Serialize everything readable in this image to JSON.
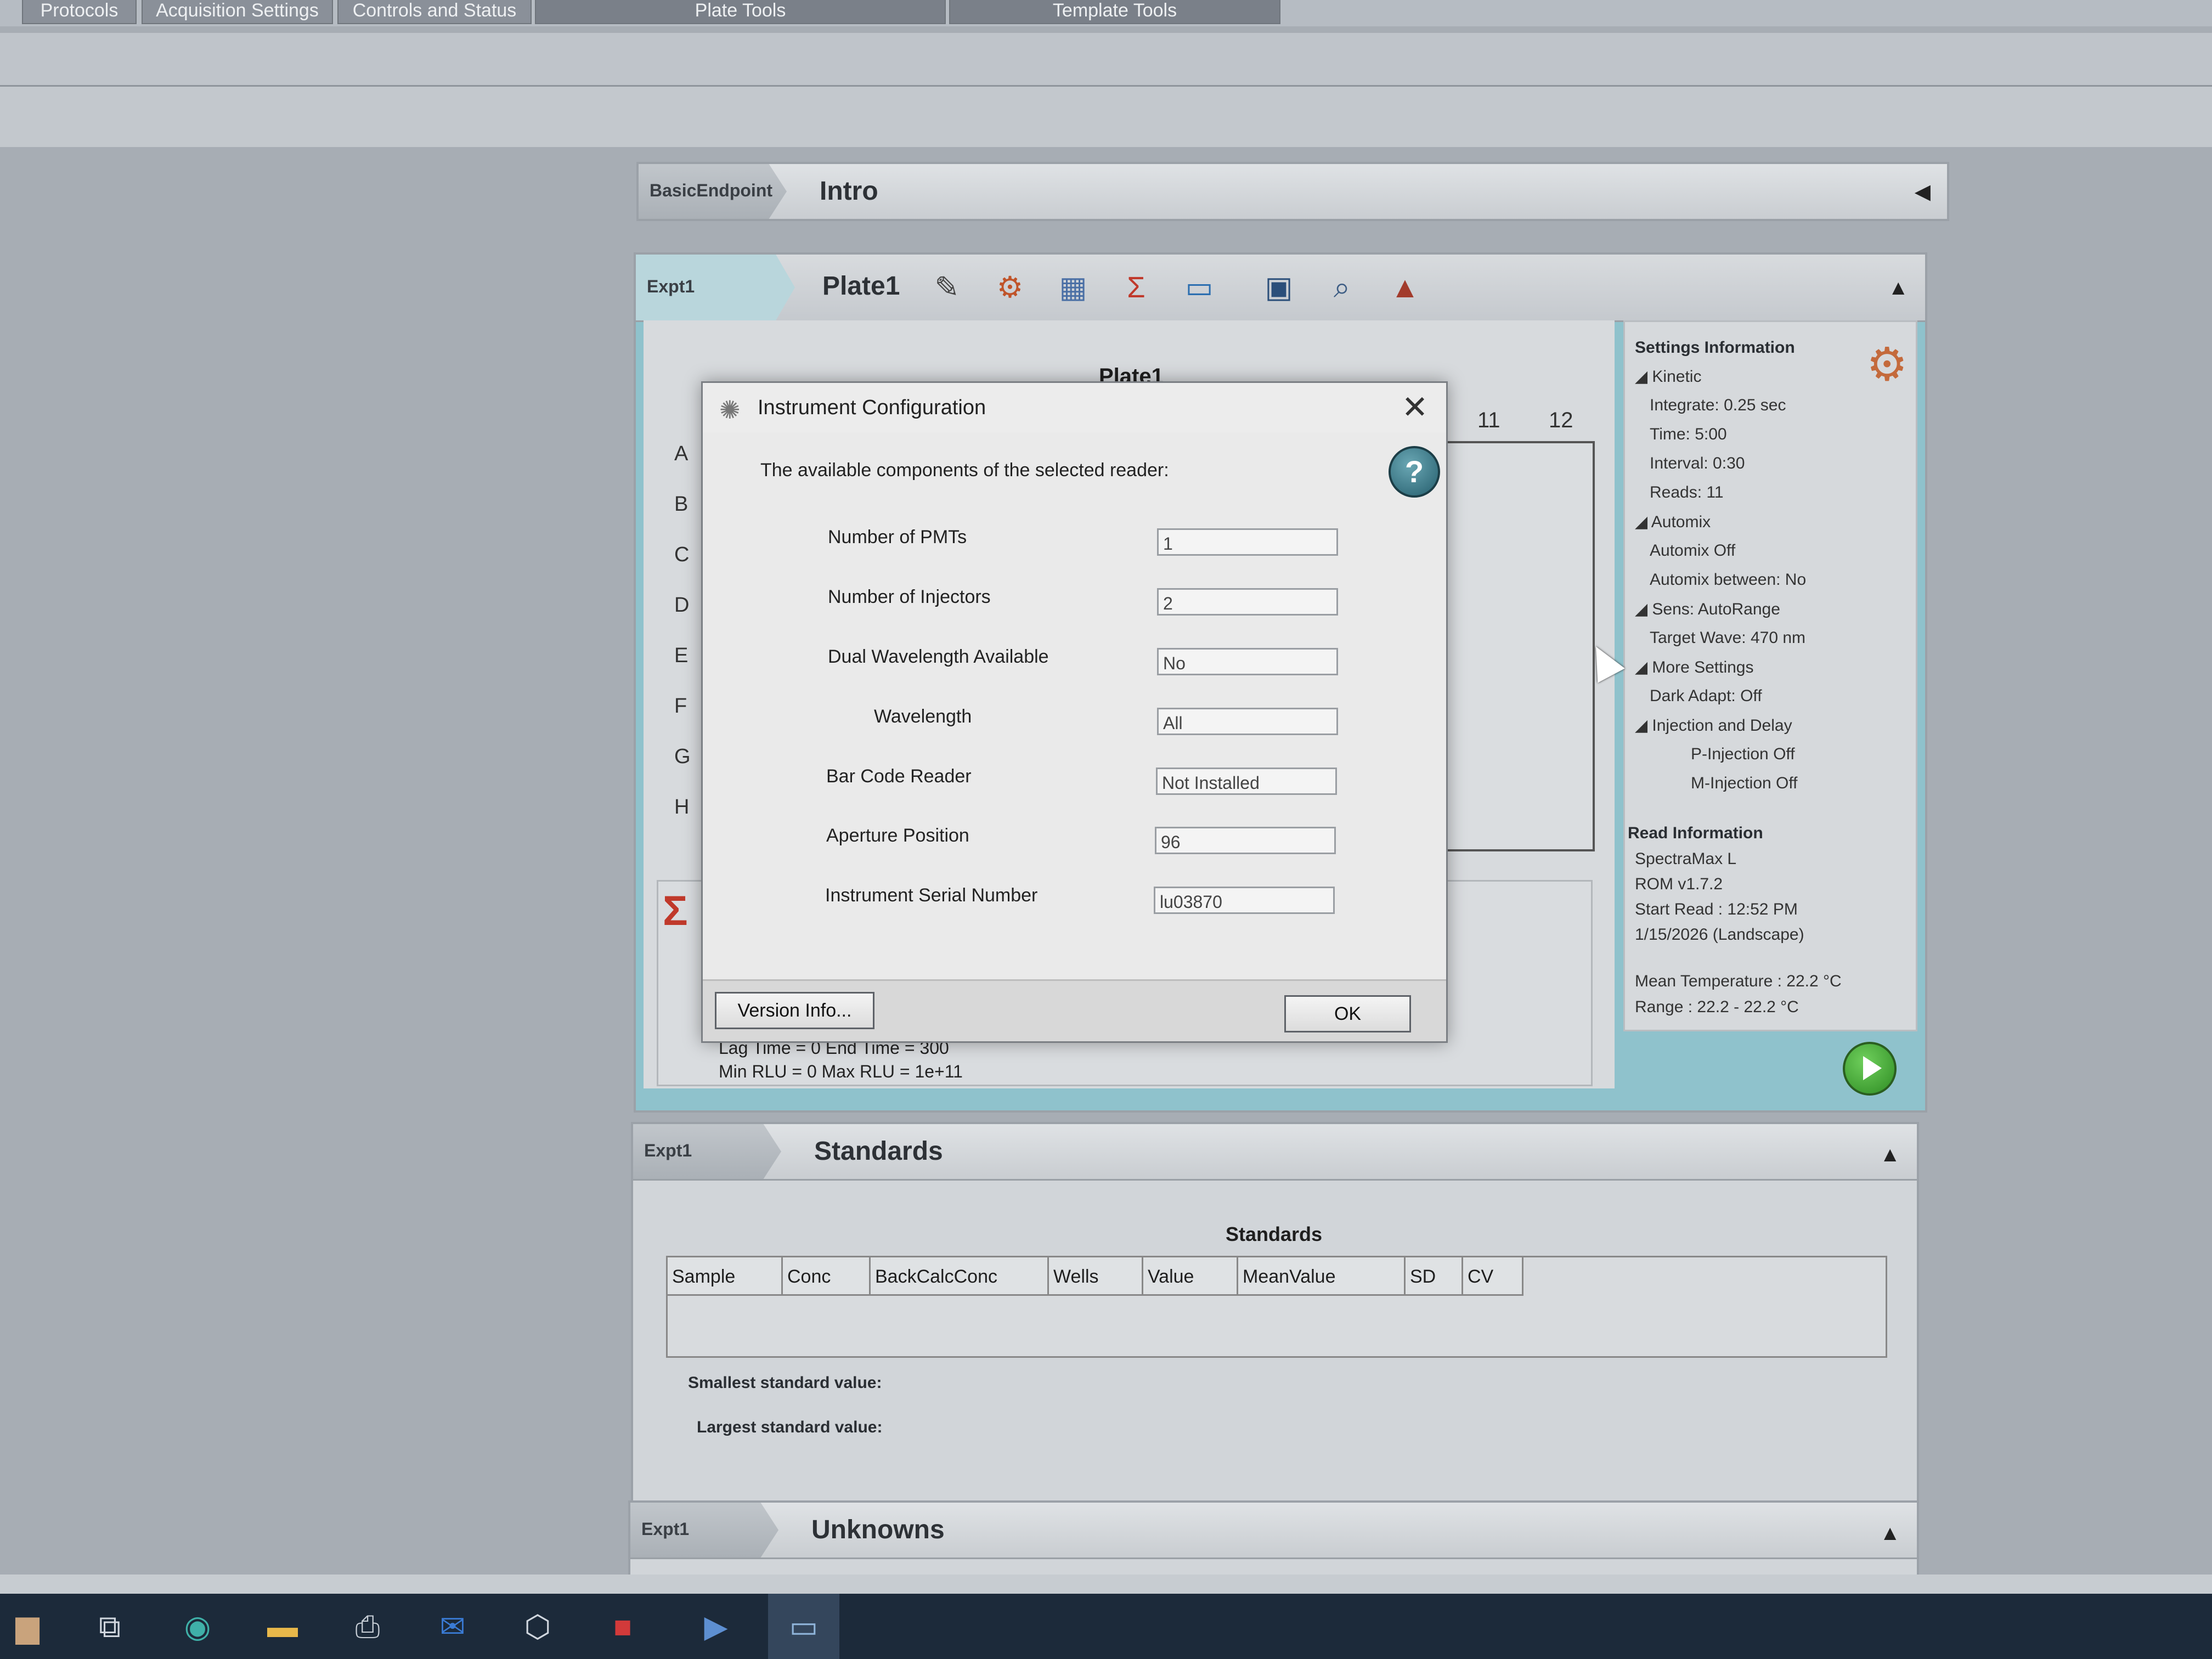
{
  "ribbon": {
    "tabs": [
      "Protocols",
      "Acquisition Settings",
      "Controls and Status",
      "Plate Tools",
      "Template Tools"
    ]
  },
  "intro_section": {
    "name": "BasicEndpoint",
    "title": "Intro",
    "collapse_icon": "triangle-left-icon"
  },
  "plate_section": {
    "name": "Expt1",
    "title": "Plate1",
    "toolbar_icons": [
      "magic-wand-icon",
      "plate-layout-icon",
      "template-icon",
      "reduction-sigma-icon",
      "display-icon",
      "graph-icon",
      "zoom-icon",
      "mask-icon"
    ],
    "plate_caption": "Plate1",
    "rows": [
      "A",
      "B",
      "C",
      "D",
      "E",
      "F",
      "G",
      "H"
    ],
    "columns_visible": [
      "11",
      "12"
    ],
    "reduction_lines": [
      "Lag Time = 0 End Time = 300",
      "Min RLU = 0 Max RLU = 1e+11"
    ],
    "settings_info": {
      "title": "Settings Information",
      "kinetic": "Kinetic",
      "integrate": "Integrate:  0.25 sec",
      "time": "Time:  5:00",
      "interval": "Interval:  0:30",
      "reads": "Reads:  11",
      "automix": "Automix",
      "automix_state": "Automix  Off",
      "automix_between": "Automix between:  No",
      "sens": "Sens: AutoRange",
      "target_wave": "Target Wave:  470 nm",
      "more_settings": "More Settings",
      "dark_adapt": "Dark Adapt:  Off",
      "injection_delay": "Injection and Delay",
      "p_injection": "P-Injection Off",
      "m_injection": "M-Injection Off",
      "read_info_title": "Read Information",
      "reader": "SpectraMax L",
      "rom": "ROM v1.7.2",
      "start_read": "Start Read : 12:52 PM",
      "date": "1/15/2026 (Landscape)",
      "mean_temp": "Mean Temperature : 22.2 °C",
      "range": "Range : 22.2 - 22.2 °C"
    }
  },
  "standards_section": {
    "name": "Expt1",
    "title": "Standards",
    "caption": "Standards",
    "columns": [
      "Sample",
      "Conc",
      "BackCalcConc",
      "Wells",
      "Value",
      "MeanValue",
      "SD",
      "CV"
    ],
    "smallest_label": "Smallest standard value:",
    "largest_label": "Largest standard value:"
  },
  "unknowns_section": {
    "name": "Expt1",
    "title": "Unknowns"
  },
  "dialog": {
    "title": "Instrument Configuration",
    "description": "The available components of the selected reader:",
    "help_label": "?",
    "fields": [
      {
        "label": "Number of PMTs",
        "value": "1"
      },
      {
        "label": "Number of Injectors",
        "value": "2"
      },
      {
        "label": "Dual Wavelength Available",
        "value": "No"
      },
      {
        "label": "Wavelength",
        "value": "All"
      },
      {
        "label": "Bar Code Reader",
        "value": "Not Installed"
      },
      {
        "label": "Aperture Position",
        "value": "96"
      },
      {
        "label": "Instrument Serial Number",
        "value": "lu03870"
      }
    ],
    "version_button": "Version Info...",
    "ok_button": "OK"
  },
  "taskbar": {
    "icons": [
      "app-icon",
      "task-view-icon",
      "edge-icon",
      "file-explorer-icon",
      "printer-icon",
      "mail-icon",
      "cube-icon",
      "app-red-icon",
      "terminal-icon",
      "softmax-icon"
    ]
  }
}
